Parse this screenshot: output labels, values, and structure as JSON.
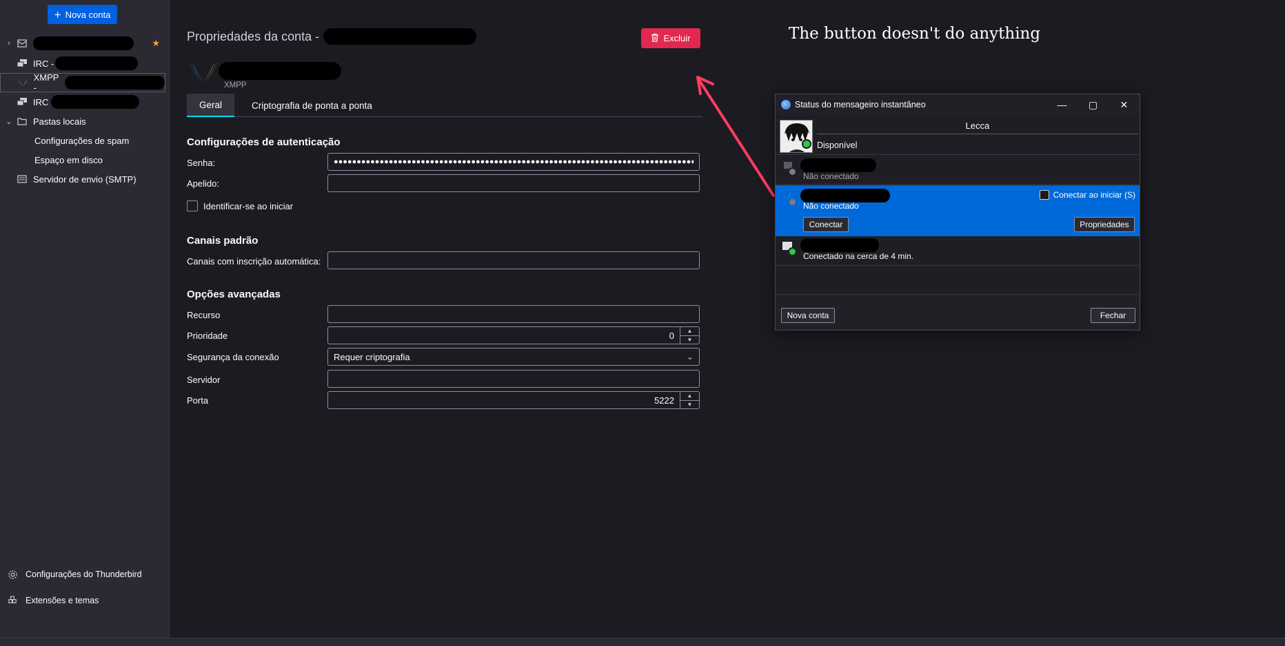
{
  "sidebar": {
    "new_account_label": "Nova conta",
    "accounts": [
      {
        "label": "",
        "type": "mail"
      },
      {
        "label": "IRC -",
        "type": "irc"
      },
      {
        "label": "XMPP -",
        "type": "xmpp"
      },
      {
        "label": "IRC",
        "type": "irc"
      }
    ],
    "local_folders_label": "Pastas locais",
    "spam_label": "Configurações de spam",
    "disk_label": "Espaço em disco",
    "smtp_label": "Servidor de envio (SMTP)",
    "settings_label": "Configurações do Thunderbird",
    "addons_label": "Extensões e temas"
  },
  "main": {
    "title": "Propriedades da conta -",
    "delete_label": "Excluir",
    "account_type": "XMPP",
    "tabs": [
      {
        "label": "Geral"
      },
      {
        "label": "Criptografia de ponta a ponta"
      }
    ],
    "auth_section": "Configurações de autenticação",
    "password_label": "Senha:",
    "password_value": "●●●●●●●●●●●●●●●●●●●●●●●●●●●●●●●●●●●●●●●●●●●●●●●●●●●●●●●●●●●●●●●●●●●●●●●●●●●●●●●●",
    "nick_label": "Apelido:",
    "nick_value": "",
    "autologin_label": "Identificar-se ao iniciar",
    "channels_section": "Canais padrão",
    "autojoin_label": "Canais com inscrição automática:",
    "autojoin_value": "",
    "advanced_section": "Opções avançadas",
    "resource_label": "Recurso",
    "resource_value": "",
    "priority_label": "Prioridade",
    "priority_value": "0",
    "security_label": "Segurança da conexão",
    "security_value": "Requer criptografia",
    "server_label": "Servidor",
    "server_value": "",
    "port_label": "Porta",
    "port_value": "5222"
  },
  "annotation": {
    "text": "The button doesn't do anything",
    "arrow_color": "#ff3d60"
  },
  "dialog": {
    "title": "Status do mensageiro instantâneo",
    "user_name": "Lecca",
    "user_status": "Disponível",
    "accounts": [
      {
        "status": "Não conectado"
      },
      {
        "status": "Não conectado",
        "autoconnect_label": "Conectar ao iniciar (S)",
        "connect_label": "Conectar",
        "properties_label": "Propriedades"
      },
      {
        "status": "Conectado na cerca de 4 min."
      }
    ],
    "new_account_label": "Nova conta",
    "close_label": "Fechar"
  },
  "colors": {
    "accent": "#0061e0",
    "danger": "#e22850",
    "selected_row": "#0069d9",
    "tab_underline": "#00ddff"
  }
}
